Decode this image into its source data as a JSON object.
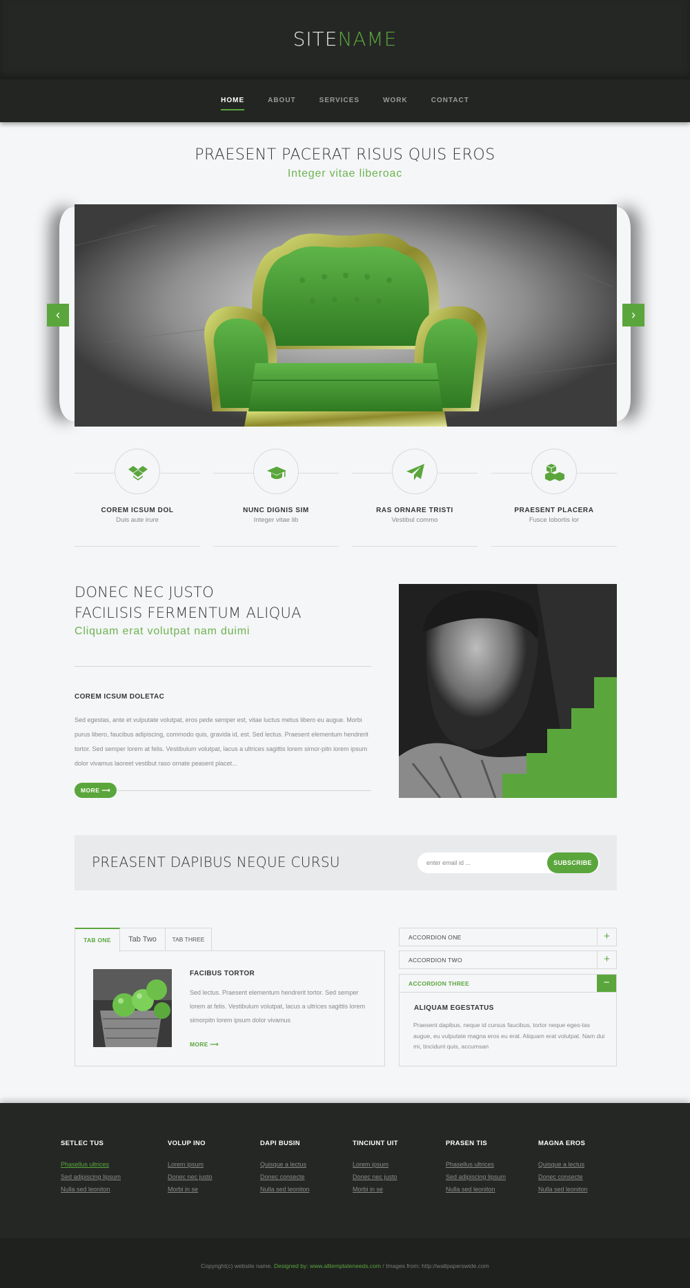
{
  "header": {
    "logo_part1": "SITE",
    "logo_part2": "NAME",
    "nav": [
      "HOME",
      "ABOUT",
      "SERVICES",
      "WORK",
      "CONTACT"
    ],
    "active_nav": "HOME"
  },
  "hero": {
    "title": "PRAESENT PACERAT RISUS QUIS EROS",
    "subtitle": "Integer vitae liberoac",
    "prev_icon": "chevron-left-icon",
    "next_icon": "chevron-right-icon"
  },
  "features": [
    {
      "icon": "dropbox-icon",
      "title": "COREM ICSUM DOL",
      "subtitle": "Duis aute irure"
    },
    {
      "icon": "graduation-cap-icon",
      "title": "NUNC DIGNIS SIM",
      "subtitle": "Integer vitae lib"
    },
    {
      "icon": "paper-plane-icon",
      "title": "RAS ORNARE TRISTI",
      "subtitle": "Vestibul commo"
    },
    {
      "icon": "cubes-icon",
      "title": "PRAESENT PLACERA",
      "subtitle": "Fusce lobortis lor"
    }
  ],
  "about": {
    "title_line1": "DONEC NEC JUSTO",
    "title_line2": "FACILISIS FERMENTUM ALIQUA",
    "subtitle": "Cliquam erat volutpat nam duimi",
    "heading": "COREM ICSUM DOLETAC",
    "paragraph": "Sed egestas, ante et vulputate volutpat, eros pede semper est, vitae luctus metus libero eu augue. Morbi purus libero, faucibus adipiscing, commodo quis, gravida id, est. Sed lectus. Praesent elementum hendrerit tortor. Sed semper lorem at felis. Vestibulum volutpat, lacus a ultrices sagittis lorem simor-pitn lorem ipsum dolor vivamus laoreet vestibut raso ornate peasent placet...",
    "more_label": "MORE"
  },
  "subscribe": {
    "title": "PREASENT DAPIBUS NEQUE CURSU",
    "placeholder": "enter email id ...",
    "button_label": "SUBSCRIBE"
  },
  "tabs": {
    "items": [
      "TAB ONE",
      "Tab Two",
      "TAB THREE"
    ],
    "active": "TAB ONE",
    "panel_title": "FACIBUS TORTOR",
    "panel_text": "Sed lectus. Praesent elementum hendrerit tortor. Sed semper lorem at felis. Vestibulum volutpat, lacus a ultrices sagittis lorem simorpitn lorem ipsum dolor vivamus",
    "more_label": "MORE"
  },
  "accordion": {
    "items": [
      {
        "label": "ACCORDION ONE",
        "toggle": "+"
      },
      {
        "label": "ACCORDION TWO",
        "toggle": "+"
      },
      {
        "label": "ACCORDION THREE",
        "toggle": "−"
      }
    ],
    "open_title": "ALIQUAM EGESTATUS",
    "open_text": "Praesent dapibus, neque id cursus faucibus, tortor neque eges-tas augue, eu vulputate magna eros eu erat. Aliquam erat volutpat. Nam dui mi, tincidunt quis, accumsan"
  },
  "footer": {
    "columns": [
      {
        "heading": "SETLEC TUS",
        "links": [
          "Phasellus ultrices",
          "Sed adipiscing lipsum",
          "Nulla sed leoniton"
        ]
      },
      {
        "heading": "VOLUP INO",
        "links": [
          "Lorem ipsum",
          "Donec nec justo",
          "Morbi in se"
        ]
      },
      {
        "heading": "DAPI BUSIN",
        "links": [
          "Quisque a lectus",
          "Donec consecte",
          "Nulla sed leoniton"
        ]
      },
      {
        "heading": "TINCIUNT UIT",
        "links": [
          "Lorem ipsum",
          "Donec nec justo",
          "Morbi in se"
        ]
      },
      {
        "heading": "PRASEN TIS",
        "links": [
          "Phasellus ultrices",
          "Sed adipiscing lipsum",
          "Nulla sed leoniton"
        ]
      },
      {
        "heading": "MAGNA EROS",
        "links": [
          "Quisque a lectus",
          "Donec consecte",
          "Nulla sed leoniton"
        ]
      }
    ],
    "copyright_text": "Copyright(c) website name.",
    "designed_by": "Designed by: www.alltemplateneeds.com",
    "separator": "/",
    "images_from": "Images from: http://wallpaperswide.com"
  },
  "colors": {
    "accent": "#5aa63c",
    "header_bg": "#252725",
    "page_bg": "#f5f6f8"
  }
}
